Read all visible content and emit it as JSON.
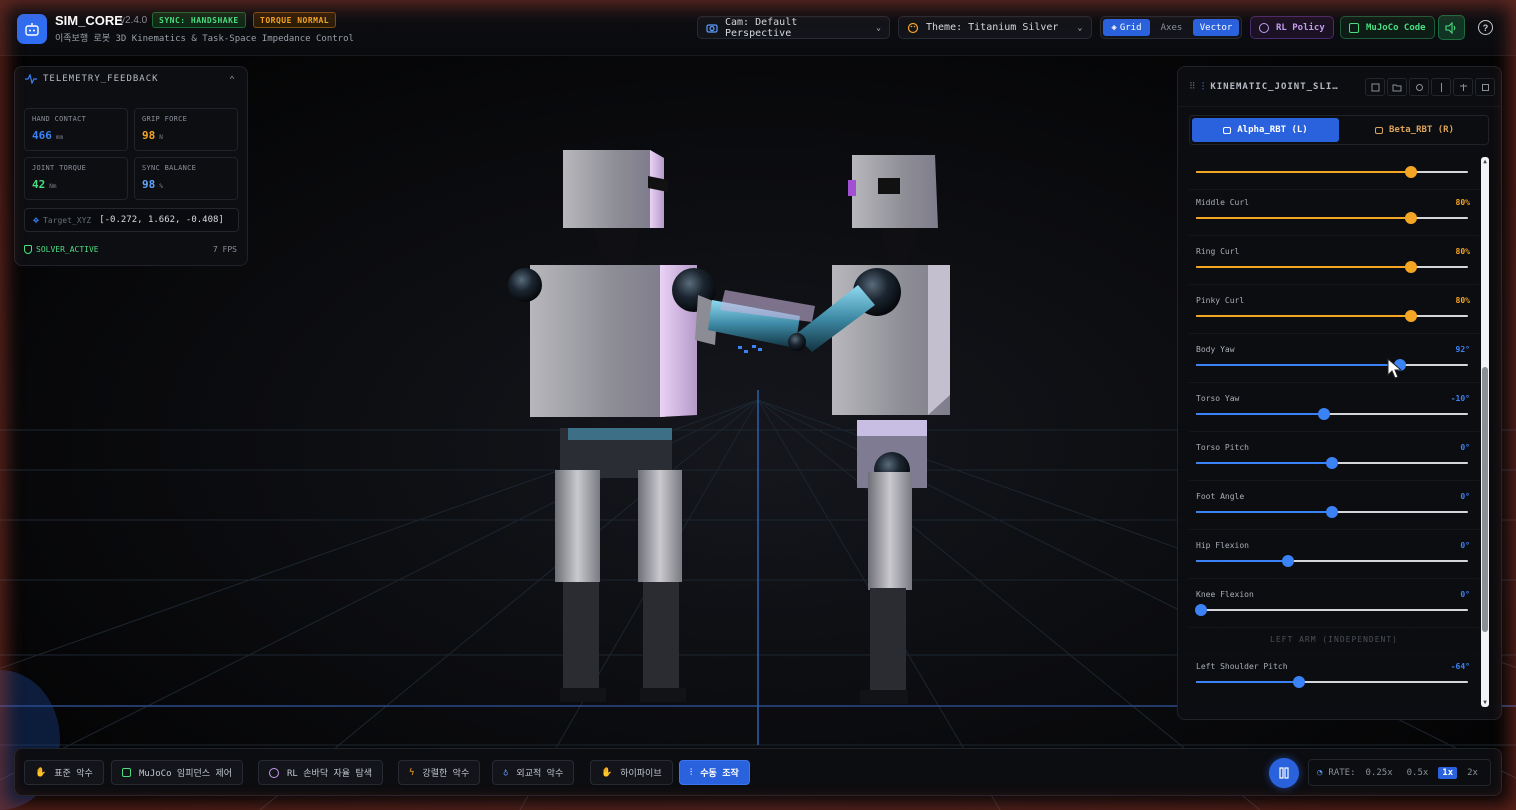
{
  "app": {
    "logo_icon": "robot-icon",
    "title": "SIM_CORE",
    "version": "v2.4.0",
    "subtitle": "이족보행 로봇 3D Kinematics & Task-Space Impedance Control"
  },
  "badges": {
    "sync": "SYNC: HANDSHAKE",
    "torque": "TORQUE NORMAL"
  },
  "header": {
    "camera": "Cam: Default Perspective",
    "theme": "Theme: Titanium Silver",
    "view_toggles": [
      {
        "label": "Grid",
        "active": true
      },
      {
        "label": "Axes",
        "active": false
      },
      {
        "label": "Vector",
        "active": true
      }
    ],
    "rl_policy": "RL Policy",
    "mujoco_code": "MuJoCo Code",
    "help": "?"
  },
  "telemetry": {
    "title": "TELEMETRY_FEEDBACK",
    "cards": [
      {
        "label": "HAND CONTACT",
        "value": "466",
        "unit": "mm",
        "color": "#3b82f6"
      },
      {
        "label": "GRIP FORCE",
        "value": "98",
        "unit": "N",
        "color": "#f5a524"
      },
      {
        "label": "JOINT TORQUE",
        "value": "42",
        "unit": "Nm",
        "color": "#4ade80"
      },
      {
        "label": "SYNC BALANCE",
        "value": "98",
        "unit": "%",
        "color": "#60a5fa"
      }
    ],
    "target_label": "Target_XYZ",
    "target_value": "[-0.272, 1.662, -0.408]",
    "solver": "SOLVER_ACTIVE",
    "fps": "7 FPS"
  },
  "panel": {
    "title": "KINEMATIC_JOINT_SLIDERS",
    "tabs": [
      {
        "label": "Alpha_RBT (L)",
        "active": true
      },
      {
        "label": "Beta_RBT (R)",
        "active": false
      }
    ],
    "sliders": [
      {
        "name": "",
        "value": "",
        "pct": 0.79,
        "color": "#f5a524"
      },
      {
        "name": "Middle Curl",
        "value": "80%",
        "pct": 0.79,
        "color": "#f5a524"
      },
      {
        "name": "Ring Curl",
        "value": "80%",
        "pct": 0.79,
        "color": "#f5a524"
      },
      {
        "name": "Pinky Curl",
        "value": "80%",
        "pct": 0.79,
        "color": "#f5a524"
      },
      {
        "name": "Body Yaw",
        "value": "92°",
        "pct": 0.75,
        "color": "#3b82f6"
      },
      {
        "name": "Torso Yaw",
        "value": "-10°",
        "pct": 0.47,
        "color": "#3b82f6"
      },
      {
        "name": "Torso Pitch",
        "value": "0°",
        "pct": 0.5,
        "color": "#3b82f6"
      },
      {
        "name": "Foot Angle",
        "value": "0°",
        "pct": 0.5,
        "color": "#3b82f6"
      },
      {
        "name": "Hip Flexion",
        "value": "0°",
        "pct": 0.34,
        "color": "#3b82f6"
      },
      {
        "name": "Knee Flexion",
        "value": "0°",
        "pct": 0.02,
        "color": "#3b82f6"
      }
    ],
    "section": "LEFT ARM (INDEPENDENT)",
    "extra_slider": {
      "name": "Left Shoulder Pitch",
      "value": "-64°",
      "pct": 0.38,
      "color": "#3b82f6"
    }
  },
  "modes": [
    {
      "label": "표준 악수",
      "icon": "hand-icon",
      "active": false
    },
    {
      "label": "MuJoCo 임피던스 제어",
      "icon": "chip-icon",
      "active": false
    },
    {
      "label": "RL 손바닥 자율 탐색",
      "icon": "brain-icon",
      "active": false
    },
    {
      "label": "강렬한 악수",
      "icon": "bolt-icon",
      "active": false
    },
    {
      "label": "외교적 악수",
      "icon": "award-icon",
      "active": false
    },
    {
      "label": "하이파이브",
      "icon": "hand-icon",
      "active": false
    },
    {
      "label": "수동 조작",
      "icon": "sliders-icon",
      "active": true
    }
  ],
  "rate": {
    "label": "RATE:",
    "options": [
      {
        "label": "0.25x",
        "active": false
      },
      {
        "label": "0.5x",
        "active": false
      },
      {
        "label": "1x",
        "active": true
      },
      {
        "label": "2x",
        "active": false
      }
    ]
  }
}
